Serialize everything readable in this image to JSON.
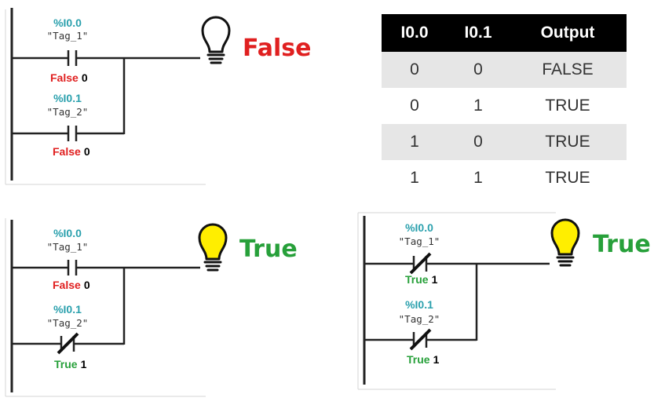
{
  "colors": {
    "address": "#2aa0ad",
    "false": "#e02020",
    "true": "#27a03a",
    "lamp_on": "#ffee00",
    "table_header": "#000000",
    "table_shade": "#e6e6e6"
  },
  "icons": {
    "lamp": "lightbulb-icon",
    "inverted_contact": "normally-closed-contact-icon"
  },
  "diagrams": [
    {
      "contacts": [
        {
          "address": "%I0.0",
          "tag": "\"Tag_1\"",
          "state_word": "False",
          "state_value": "0",
          "contact_type": "normally-open"
        },
        {
          "address": "%I0.1",
          "tag": "\"Tag_2\"",
          "state_word": "False",
          "state_value": "0",
          "contact_type": "normally-open"
        }
      ],
      "output": "False",
      "lamp_on": false
    },
    {
      "contacts": [
        {
          "address": "%I0.0",
          "tag": "\"Tag_1\"",
          "state_word": "False",
          "state_value": "0",
          "contact_type": "normally-open"
        },
        {
          "address": "%I0.1",
          "tag": "\"Tag_2\"",
          "state_word": "True",
          "state_value": "1",
          "contact_type": "normally-closed"
        }
      ],
      "output": "True",
      "lamp_on": true
    },
    {
      "contacts": [
        {
          "address": "%I0.0",
          "tag": "\"Tag_1\"",
          "state_word": "True",
          "state_value": "1",
          "contact_type": "normally-closed"
        },
        {
          "address": "%I0.1",
          "tag": "\"Tag_2\"",
          "state_word": "True",
          "state_value": "1",
          "contact_type": "normally-closed"
        }
      ],
      "output": "True",
      "lamp_on": true
    }
  ],
  "truth_table": {
    "headers": [
      "I0.0",
      "I0.1",
      "Output"
    ],
    "rows": [
      [
        "0",
        "0",
        "FALSE"
      ],
      [
        "0",
        "1",
        "TRUE"
      ],
      [
        "1",
        "0",
        "TRUE"
      ],
      [
        "1",
        "1",
        "TRUE"
      ]
    ]
  }
}
